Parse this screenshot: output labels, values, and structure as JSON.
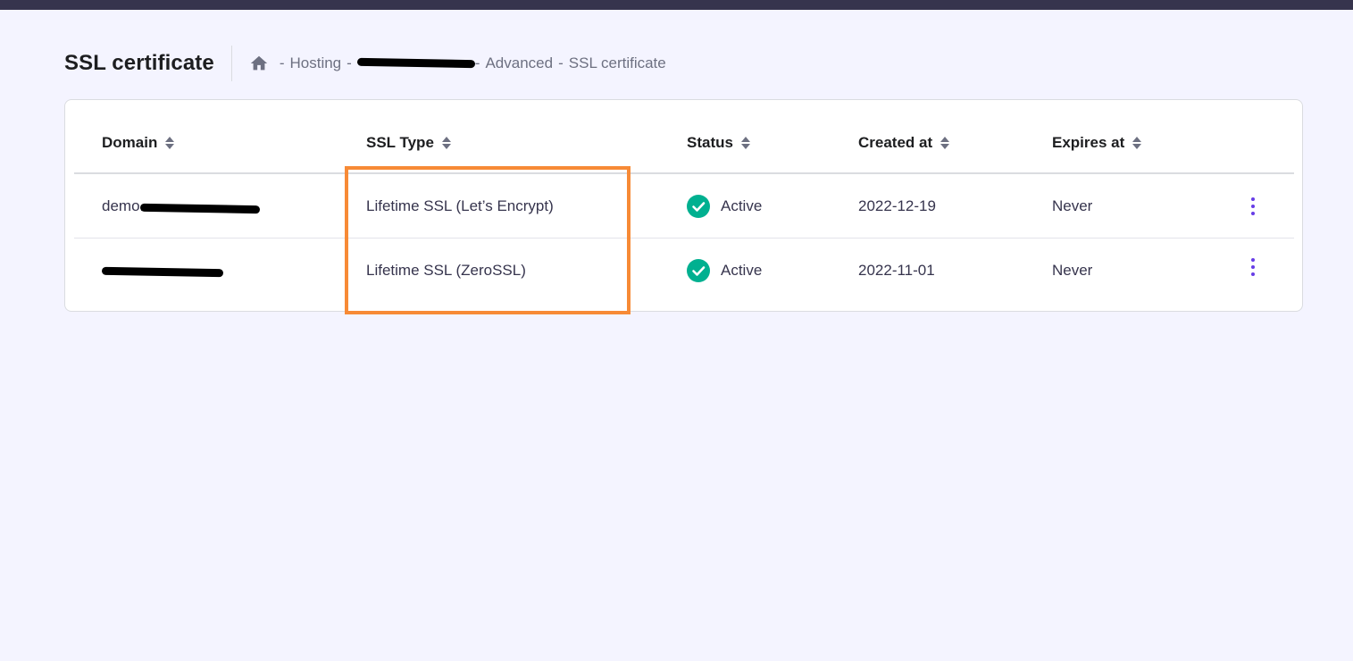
{
  "header": {
    "title": "SSL certificate",
    "breadcrumb": {
      "sep": "-",
      "hosting": "Hosting",
      "advanced": "Advanced",
      "ssl": "SSL certificate"
    }
  },
  "table": {
    "columns": {
      "domain": "Domain",
      "ssl_type": "SSL Type",
      "status": "Status",
      "created_at": "Created at",
      "expires_at": "Expires at"
    },
    "rows": [
      {
        "domain_prefix": "demo.",
        "ssl_type": "Lifetime SSL (Let’s Encrypt)",
        "status": "Active",
        "created_at": "2022-12-19",
        "expires_at": "Never"
      },
      {
        "domain_prefix": "",
        "ssl_type": "Lifetime SSL (ZeroSSL)",
        "status": "Active",
        "created_at": "2022-11-01",
        "expires_at": "Never"
      }
    ]
  },
  "colors": {
    "accent": "#673de6",
    "status_active": "#00b090",
    "highlight": "#f78a36",
    "topbar": "#36344d"
  },
  "icons": {
    "home": "home-icon",
    "sort": "sort-icon",
    "status": "check-circle-icon",
    "menu": "kebab-menu-icon"
  }
}
